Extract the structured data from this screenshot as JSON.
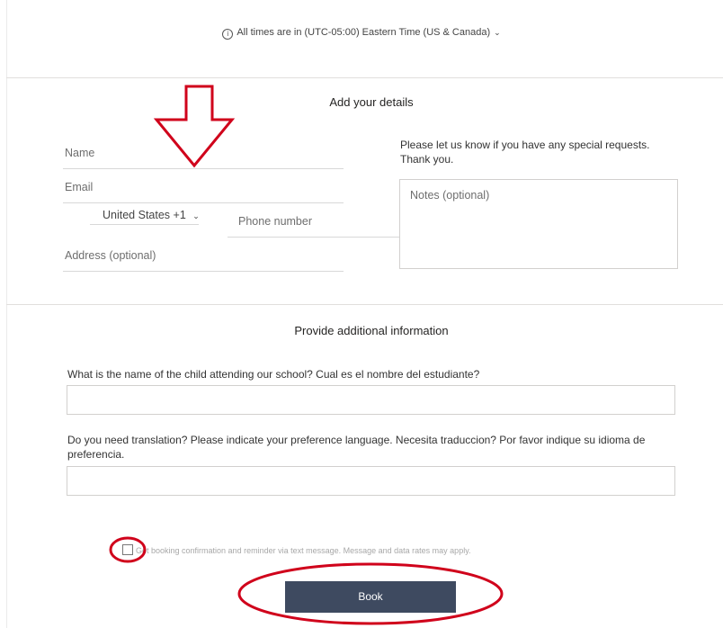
{
  "timezone": {
    "text": "All times are in  (UTC-05:00) Eastern Time (US & Canada)",
    "info_icon": "ⓘ",
    "chevron": "﹀"
  },
  "details": {
    "heading": "Add your details",
    "name_placeholder": "Name",
    "email_placeholder": "Email",
    "country_code": "United States +1",
    "phone_placeholder": "Phone number",
    "address_placeholder": "Address (optional)",
    "special_requests": "Please let us know if you have any special requests. Thank you.",
    "notes_placeholder": "Notes (optional)"
  },
  "additional": {
    "heading": "Provide additional information",
    "q1": "What is the name of the child attending our school? Cual es el nombre del estudiante?",
    "q2": "Do you need translation? Please indicate your preference language. Necesita traduccion? Por favor indique su idioma de preferencia."
  },
  "sms_consent": {
    "label": "Get booking confirmation and reminder via text message. Message and data rates may apply.",
    "checked": false
  },
  "book_button": "Book",
  "annotation_color": "#d0021b"
}
